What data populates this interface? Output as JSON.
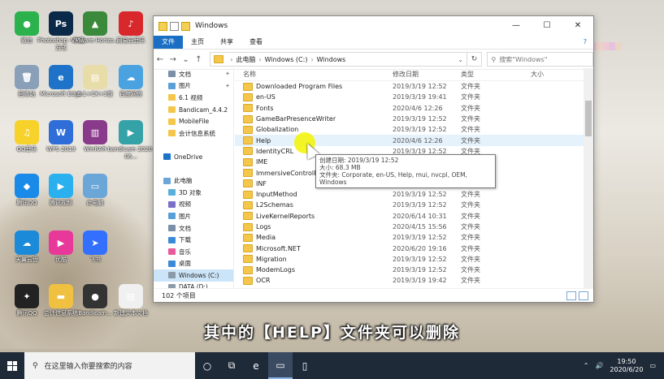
{
  "desktop_icons": [
    {
      "label": "微信",
      "icon": "wechat-icon",
      "color": "#2bb24c",
      "glyph": "●"
    },
    {
      "label": "Photoshop - 快捷方式",
      "icon": "photoshop-icon",
      "color": "#0b2a4a",
      "glyph": "Ps"
    },
    {
      "label": "VMware Horizo...",
      "icon": "vmware-icon",
      "color": "#3b8a3b",
      "glyph": "▲"
    },
    {
      "label": "网易云音乐",
      "icon": "netease-music-icon",
      "color": "#d8282b",
      "glyph": "♪"
    },
    {
      "label": "回收站",
      "icon": "recycle-bin-icon",
      "color": "#8aa0b8",
      "glyph": "🗑"
    },
    {
      "label": "Microsoft Edge",
      "icon": "edge-icon",
      "color": "#1e73c8",
      "glyph": "e"
    },
    {
      "label": "6.1+CK+3前",
      "icon": "document-icon",
      "color": "#e8dca8",
      "glyph": "▤"
    },
    {
      "label": "百度网盘",
      "icon": "baidu-netdisk-icon",
      "color": "#4aa3e0",
      "glyph": "☁"
    },
    {
      "label": "QQ音乐",
      "icon": "qq-music-icon",
      "color": "#f6d22a",
      "glyph": "♫"
    },
    {
      "label": "WPS 2019",
      "icon": "wps-icon",
      "color": "#2f6ed8",
      "glyph": "W"
    },
    {
      "label": "WinRAR",
      "icon": "winrar-icon",
      "color": "#8a3a8a",
      "glyph": "▥"
    },
    {
      "label": "bandicam 2020-06...",
      "icon": "video-file-icon",
      "color": "#35a2a8",
      "glyph": "▶"
    },
    {
      "label": "腾讯QQ",
      "icon": "tencent-icon",
      "color": "#1a8ae8",
      "glyph": "◆"
    },
    {
      "label": "腾讯视频",
      "icon": "tencent-video-icon",
      "color": "#2ab0ef",
      "glyph": "▶"
    },
    {
      "label": "此电脑",
      "icon": "this-pc-icon",
      "color": "#6aa6d8",
      "glyph": "▭"
    },
    {
      "label": "天翼云盘",
      "icon": "tianyi-cloud-icon",
      "color": "#1b8ad8",
      "glyph": "☁"
    },
    {
      "label": "优酷",
      "icon": "youku-icon",
      "color": "#e8389a",
      "glyph": "▶"
    },
    {
      "label": "飞书",
      "icon": "feishu-icon",
      "color": "#3370ff",
      "glyph": "➤"
    },
    {
      "label": "腾讯QQ",
      "icon": "qq-icon",
      "color": "#222",
      "glyph": "✦"
    },
    {
      "label": "会计信息系统",
      "icon": "folder-icon",
      "color": "#f0c040",
      "glyph": "▬"
    },
    {
      "label": "Bandicam...",
      "icon": "bandicam-icon",
      "color": "#333",
      "glyph": "●"
    },
    {
      "label": "新建文本文档",
      "icon": "text-file-icon",
      "color": "#f0f0f0",
      "glyph": "▤"
    }
  ],
  "window": {
    "title": "Windows",
    "controls": {
      "minimize": "—",
      "maximize": "☐",
      "close": "✕"
    },
    "ribbon_tabs": [
      "文件",
      "主页",
      "共享",
      "查看"
    ],
    "help": "?",
    "address": {
      "crumbs": [
        "此电脑",
        "Windows (C:)",
        "Windows"
      ],
      "sep": "›"
    },
    "search_placeholder": "搜索\"Windows\"",
    "nav": [
      {
        "label": "文档",
        "icon": "documents-icon",
        "pinned": true
      },
      {
        "label": "图片",
        "icon": "pictures-icon",
        "pinned": true
      },
      {
        "label": "6.1 视频",
        "icon": "folder-icon",
        "pinned": false
      },
      {
        "label": "Bandicam_4.4.2",
        "icon": "folder-icon",
        "pinned": false
      },
      {
        "label": "MobileFile",
        "icon": "folder-icon",
        "pinned": false
      },
      {
        "label": "会计信息系统",
        "icon": "folder-icon",
        "pinned": false
      },
      {
        "label": "",
        "icon": "",
        "pinned": false
      },
      {
        "label": "OneDrive",
        "icon": "onedrive-icon",
        "pinned": false
      },
      {
        "label": "",
        "icon": "",
        "pinned": false
      },
      {
        "label": "此电脑",
        "icon": "this-pc-icon",
        "pinned": false
      },
      {
        "label": "3D 对象",
        "icon": "3d-objects-icon",
        "pinned": false
      },
      {
        "label": "视频",
        "icon": "videos-icon",
        "pinned": false
      },
      {
        "label": "图片",
        "icon": "pictures-icon",
        "pinned": false
      },
      {
        "label": "文档",
        "icon": "documents-icon",
        "pinned": false
      },
      {
        "label": "下载",
        "icon": "downloads-icon",
        "pinned": false
      },
      {
        "label": "音乐",
        "icon": "music-icon",
        "pinned": false
      },
      {
        "label": "桌面",
        "icon": "desktop-icon",
        "pinned": false
      },
      {
        "label": "Windows (C:)",
        "icon": "drive-icon",
        "pinned": false,
        "selected": true
      },
      {
        "label": "DATA (D:)",
        "icon": "drive-icon",
        "pinned": false
      }
    ],
    "columns": {
      "name": "名称",
      "date": "修改日期",
      "type": "类型",
      "size": "大小"
    },
    "files": [
      {
        "name": "Downloaded Program Files",
        "date": "2019/3/19 12:52",
        "type": "文件夹"
      },
      {
        "name": "en-US",
        "date": "2019/3/19 19:41",
        "type": "文件夹"
      },
      {
        "name": "Fonts",
        "date": "2020/4/6 12:26",
        "type": "文件夹"
      },
      {
        "name": "GameBarPresenceWriter",
        "date": "2019/3/19 12:52",
        "type": "文件夹"
      },
      {
        "name": "Globalization",
        "date": "2019/3/19 12:52",
        "type": "文件夹"
      },
      {
        "name": "Help",
        "date": "2020/4/6 12:26",
        "type": "文件夹",
        "highlight": true
      },
      {
        "name": "IdentityCRL",
        "date": "2019/3/19 12:52",
        "type": "文件夹"
      },
      {
        "name": "IME",
        "date": "",
        "type": ""
      },
      {
        "name": "ImmersiveControlPanel",
        "date": "",
        "type": ""
      },
      {
        "name": "INF",
        "date": "2020/6/19 9:05",
        "type": "文件夹"
      },
      {
        "name": "InputMethod",
        "date": "2019/3/19 12:52",
        "type": "文件夹"
      },
      {
        "name": "L2Schemas",
        "date": "2019/3/19 12:52",
        "type": "文件夹"
      },
      {
        "name": "LiveKernelReports",
        "date": "2020/6/14 10:31",
        "type": "文件夹"
      },
      {
        "name": "Logs",
        "date": "2020/4/15 15:56",
        "type": "文件夹"
      },
      {
        "name": "Media",
        "date": "2019/3/19 12:52",
        "type": "文件夹"
      },
      {
        "name": "Microsoft.NET",
        "date": "2020/6/20 19:16",
        "type": "文件夹"
      },
      {
        "name": "Migration",
        "date": "2019/3/19 12:52",
        "type": "文件夹"
      },
      {
        "name": "ModemLogs",
        "date": "2019/3/19 12:52",
        "type": "文件夹"
      },
      {
        "name": "OCR",
        "date": "2019/3/19 19:42",
        "type": "文件夹"
      }
    ],
    "tooltip": {
      "created": "创建日期: 2019/3/19 12:52",
      "size": "大小: 68.3 MB",
      "files": "文件夹: Corporate, en-US, Help, mui, nvcpl, OEM, Windows"
    },
    "status": "102 个项目"
  },
  "caption": "其中的【HELP】文件夹可以删除",
  "taskbar": {
    "search_placeholder": "在这里输入你要搜索的内容",
    "apps": [
      {
        "icon": "task-view-icon",
        "glyph": "○"
      },
      {
        "icon": "task-view-split-icon",
        "glyph": "⧉"
      },
      {
        "icon": "edge-icon",
        "glyph": "e"
      },
      {
        "icon": "file-explorer-icon",
        "glyph": "▭",
        "active": true
      },
      {
        "icon": "phone-app-icon",
        "glyph": "▯"
      }
    ],
    "time": "19:50",
    "date": "2020/6/20"
  }
}
